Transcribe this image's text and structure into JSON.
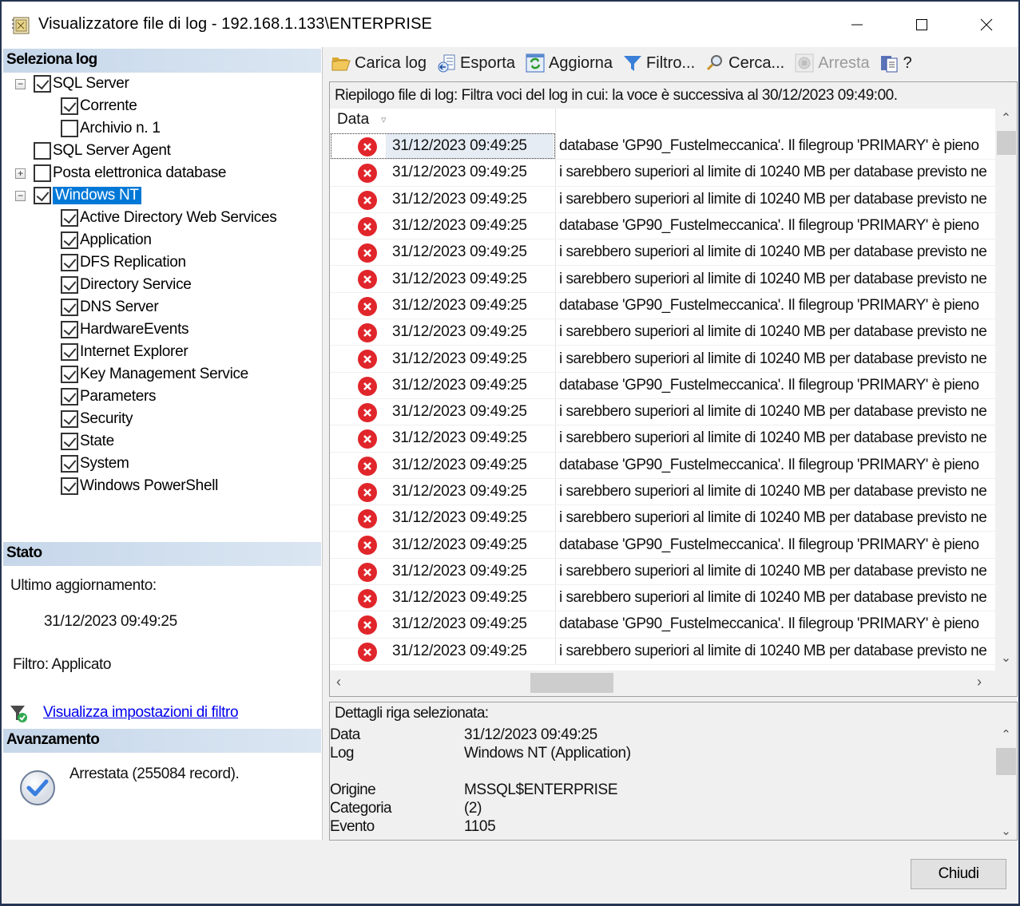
{
  "window": {
    "title": "Visualizzatore file di log - 192.168.1.133\\ENTERPRISE",
    "controls": [
      "minimize",
      "maximize",
      "close"
    ]
  },
  "left_panel": {
    "select_log_header": "Seleziona log",
    "tree": [
      {
        "label": "SQL Server",
        "checked": true,
        "expander": "−",
        "level": 0
      },
      {
        "label": "Corrente",
        "checked": true,
        "level": 1
      },
      {
        "label": "Archivio n. 1",
        "checked": false,
        "level": 1
      },
      {
        "label": "SQL Server Agent",
        "checked": false,
        "level": 0
      },
      {
        "label": "Posta elettronica database",
        "checked": false,
        "expander": "+",
        "level": 0
      },
      {
        "label": "Windows NT",
        "checked": true,
        "expander": "−",
        "level": 0,
        "selected": true
      },
      {
        "label": "Active Directory Web Services",
        "checked": true,
        "level": 1
      },
      {
        "label": "Application",
        "checked": true,
        "level": 1
      },
      {
        "label": "DFS Replication",
        "checked": true,
        "level": 1
      },
      {
        "label": "Directory Service",
        "checked": true,
        "level": 1
      },
      {
        "label": "DNS Server",
        "checked": true,
        "level": 1
      },
      {
        "label": "HardwareEvents",
        "checked": true,
        "level": 1
      },
      {
        "label": "Internet Explorer",
        "checked": true,
        "level": 1
      },
      {
        "label": "Key Management Service",
        "checked": true,
        "level": 1
      },
      {
        "label": "Parameters",
        "checked": true,
        "level": 1
      },
      {
        "label": "Security",
        "checked": true,
        "level": 1
      },
      {
        "label": "State",
        "checked": true,
        "level": 1
      },
      {
        "label": "System",
        "checked": true,
        "level": 1
      },
      {
        "label": "Windows PowerShell",
        "checked": true,
        "level": 1
      }
    ],
    "status_header": "Stato",
    "last_update_label": "Ultimo aggiornamento:",
    "last_update_value": "31/12/2023 09:49:25",
    "filter_status": "Filtro: Applicato",
    "filter_link": "Visualizza impostazioni di filtro",
    "progress_header": "Avanzamento",
    "progress_text": "Arrestata (255084 record)."
  },
  "toolbar": {
    "items": [
      {
        "label": "Carica log",
        "icon": "folder-open-icon",
        "enabled": true
      },
      {
        "label": "Esporta",
        "icon": "export-icon",
        "enabled": true
      },
      {
        "label": "Aggiorna",
        "icon": "refresh-icon",
        "enabled": true
      },
      {
        "label": "Filtro...",
        "icon": "filter-icon",
        "enabled": true
      },
      {
        "label": "Cerca...",
        "icon": "search-icon",
        "enabled": true
      },
      {
        "label": "Arresta",
        "icon": "stop-icon",
        "enabled": false
      },
      {
        "label": "?",
        "icon": "help-icon",
        "enabled": true
      }
    ]
  },
  "grid": {
    "summary": "Riepilogo file di log: Filtra voci del log in cui: la voce è successiva al 30/12/2023 09:49:00.",
    "column_date": "Data",
    "rows": [
      {
        "date": "31/12/2023 09:49:25",
        "message": "database 'GP90_Fustelmeccanica'. Il filegroup 'PRIMARY' è pieno",
        "level": "error"
      },
      {
        "date": "31/12/2023 09:49:25",
        "message": "i sarebbero superiori al limite di 10240 MB per database previsto ne",
        "level": "error"
      },
      {
        "date": "31/12/2023 09:49:25",
        "message": "i sarebbero superiori al limite di 10240 MB per database previsto ne",
        "level": "error"
      },
      {
        "date": "31/12/2023 09:49:25",
        "message": "database 'GP90_Fustelmeccanica'. Il filegroup 'PRIMARY' è pieno",
        "level": "error"
      },
      {
        "date": "31/12/2023 09:49:25",
        "message": "i sarebbero superiori al limite di 10240 MB per database previsto ne",
        "level": "error"
      },
      {
        "date": "31/12/2023 09:49:25",
        "message": "i sarebbero superiori al limite di 10240 MB per database previsto ne",
        "level": "error"
      },
      {
        "date": "31/12/2023 09:49:25",
        "message": "database 'GP90_Fustelmeccanica'. Il filegroup 'PRIMARY' è pieno",
        "level": "error"
      },
      {
        "date": "31/12/2023 09:49:25",
        "message": "i sarebbero superiori al limite di 10240 MB per database previsto ne",
        "level": "error"
      },
      {
        "date": "31/12/2023 09:49:25",
        "message": "i sarebbero superiori al limite di 10240 MB per database previsto ne",
        "level": "error"
      },
      {
        "date": "31/12/2023 09:49:25",
        "message": "database 'GP90_Fustelmeccanica'. Il filegroup 'PRIMARY' è pieno",
        "level": "error"
      },
      {
        "date": "31/12/2023 09:49:25",
        "message": "i sarebbero superiori al limite di 10240 MB per database previsto ne",
        "level": "error"
      },
      {
        "date": "31/12/2023 09:49:25",
        "message": "i sarebbero superiori al limite di 10240 MB per database previsto ne",
        "level": "error"
      },
      {
        "date": "31/12/2023 09:49:25",
        "message": "database 'GP90_Fustelmeccanica'. Il filegroup 'PRIMARY' è pieno",
        "level": "error"
      },
      {
        "date": "31/12/2023 09:49:25",
        "message": "i sarebbero superiori al limite di 10240 MB per database previsto ne",
        "level": "error"
      },
      {
        "date": "31/12/2023 09:49:25",
        "message": "i sarebbero superiori al limite di 10240 MB per database previsto ne",
        "level": "error"
      },
      {
        "date": "31/12/2023 09:49:25",
        "message": "database 'GP90_Fustelmeccanica'. Il filegroup 'PRIMARY' è pieno",
        "level": "error"
      },
      {
        "date": "31/12/2023 09:49:25",
        "message": "i sarebbero superiori al limite di 10240 MB per database previsto ne",
        "level": "error"
      },
      {
        "date": "31/12/2023 09:49:25",
        "message": "i sarebbero superiori al limite di 10240 MB per database previsto ne",
        "level": "error"
      },
      {
        "date": "31/12/2023 09:49:25",
        "message": "database 'GP90_Fustelmeccanica'. Il filegroup 'PRIMARY' è pieno",
        "level": "error"
      },
      {
        "date": "31/12/2023 09:49:25",
        "message": "i sarebbero superiori al limite di 10240 MB per database previsto ne",
        "level": "error"
      }
    ],
    "selected_index": 0
  },
  "details": {
    "title": "Dettagli riga selezionata:",
    "fields": [
      {
        "key": "Data",
        "value": "31/12/2023 09:49:25"
      },
      {
        "key": "Log",
        "value": "Windows NT (Application)"
      },
      {
        "key": "",
        "value": ""
      },
      {
        "key": "Origine",
        "value": "MSSQL$ENTERPRISE"
      },
      {
        "key": "Categoria",
        "value": "(2)"
      },
      {
        "key": "Evento",
        "value": "1105"
      }
    ]
  },
  "buttons": {
    "close": "Chiudi"
  },
  "colors": {
    "error": "#e0262b",
    "selection": "#0078d7",
    "link": "#0000ee",
    "section_header": "#c6d7ea"
  }
}
